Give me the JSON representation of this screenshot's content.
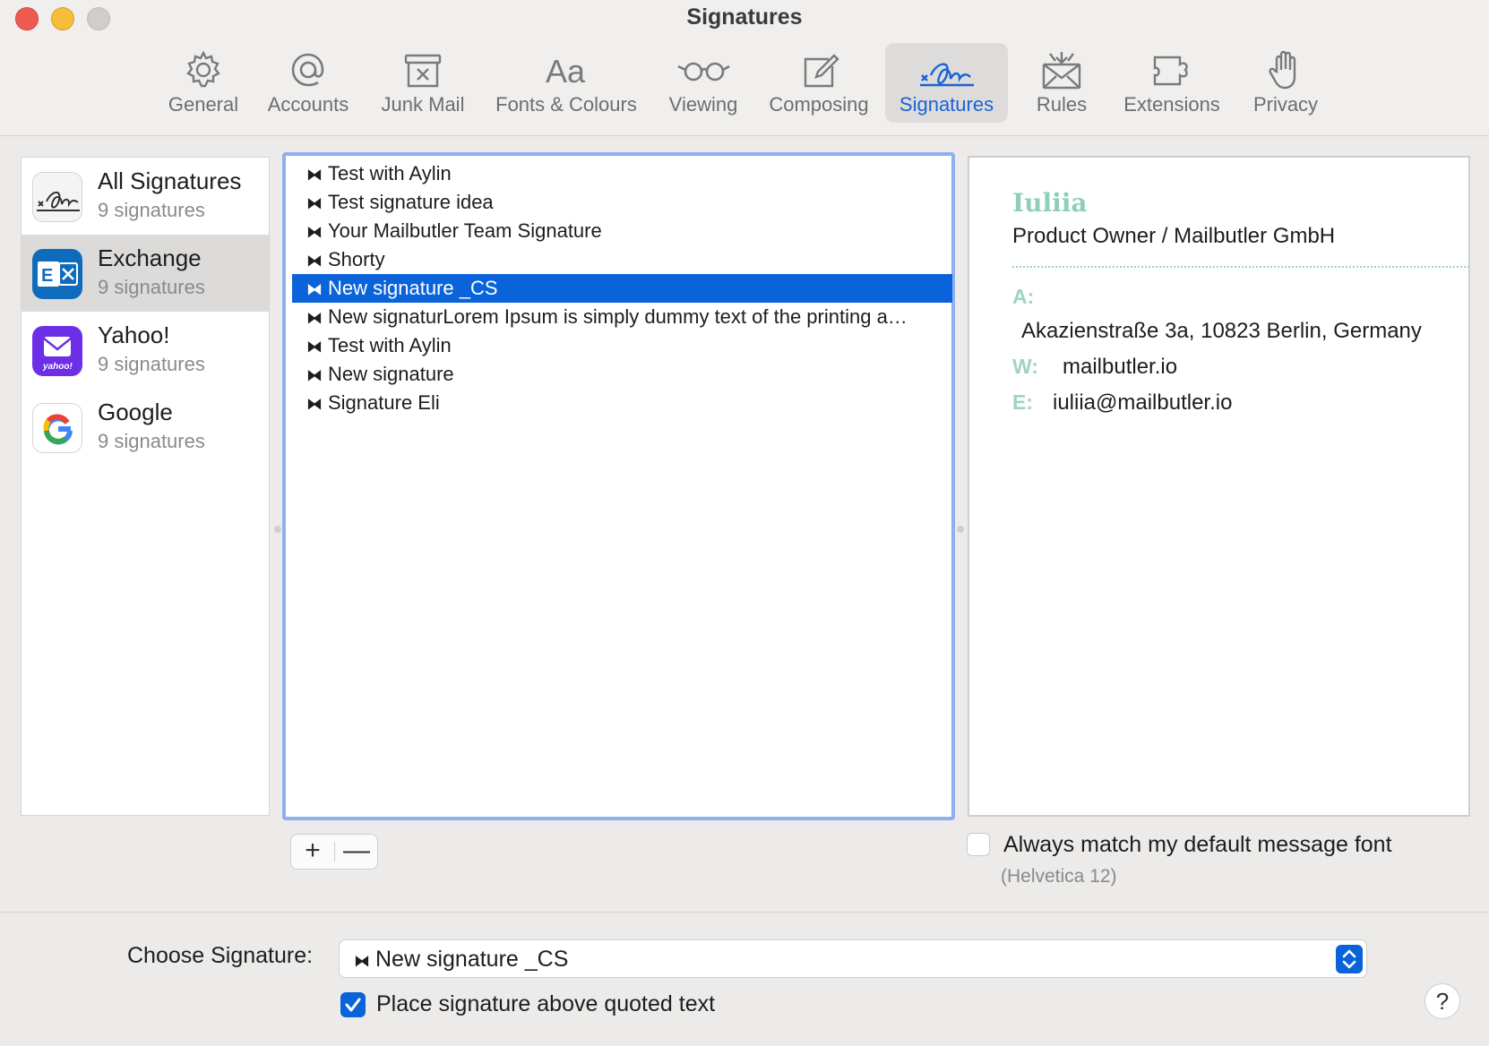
{
  "window": {
    "title": "Signatures"
  },
  "toolbar": {
    "tabs": [
      {
        "label": "General",
        "icon": "gear-icon"
      },
      {
        "label": "Accounts",
        "icon": "at-icon"
      },
      {
        "label": "Junk Mail",
        "icon": "junk-icon"
      },
      {
        "label": "Fonts & Colours",
        "icon": "fonts-icon"
      },
      {
        "label": "Viewing",
        "icon": "glasses-icon"
      },
      {
        "label": "Composing",
        "icon": "compose-icon"
      },
      {
        "label": "Signatures",
        "icon": "signature-icon",
        "active": true
      },
      {
        "label": "Rules",
        "icon": "rules-icon"
      },
      {
        "label": "Extensions",
        "icon": "puzzle-icon"
      },
      {
        "label": "Privacy",
        "icon": "hand-icon"
      }
    ]
  },
  "accounts": [
    {
      "name": "All Signatures",
      "count": "9 signatures",
      "icon": "all-signatures-icon"
    },
    {
      "name": "Exchange",
      "count": "9 signatures",
      "icon": "exchange-icon",
      "selected": true
    },
    {
      "name": "Yahoo!",
      "count": "9 signatures",
      "icon": "yahoo-icon"
    },
    {
      "name": "Google",
      "count": "9 signatures",
      "icon": "google-icon"
    }
  ],
  "signatures": [
    "Test with Aylin",
    "Test signature idea",
    "Your Mailbutler Team Signature",
    "Shorty",
    "New signature _CS",
    "New signaturLorem Ipsum is simply dummy text of the printing a…",
    "Test with Aylin",
    "New signature",
    "Signature Eli"
  ],
  "selected_signature_index": 4,
  "list_buttons": {
    "add": "+",
    "remove": "—"
  },
  "preview": {
    "name": "Iuliia",
    "role": "Product Owner / Mailbutler GmbH",
    "address_label": "A:",
    "address": "Akazienstraße 3a, 10823 Berlin, Germany",
    "web_label": "W:",
    "web": "mailbutler.io",
    "email_label": "E:",
    "email": "iuliia@mailbutler.io"
  },
  "font_option": {
    "label": "Always match my default message font",
    "sub": "(Helvetica 12)",
    "checked": false
  },
  "choose": {
    "label": "Choose Signature:",
    "value": "New signature _CS"
  },
  "place_option": {
    "label": "Place signature above quoted text",
    "checked": true
  },
  "help": "?",
  "colors": {
    "accent": "#0b63d9",
    "preview_green": "#8fcfba",
    "close": "#ee5b53",
    "minimize": "#f5bd3a"
  }
}
